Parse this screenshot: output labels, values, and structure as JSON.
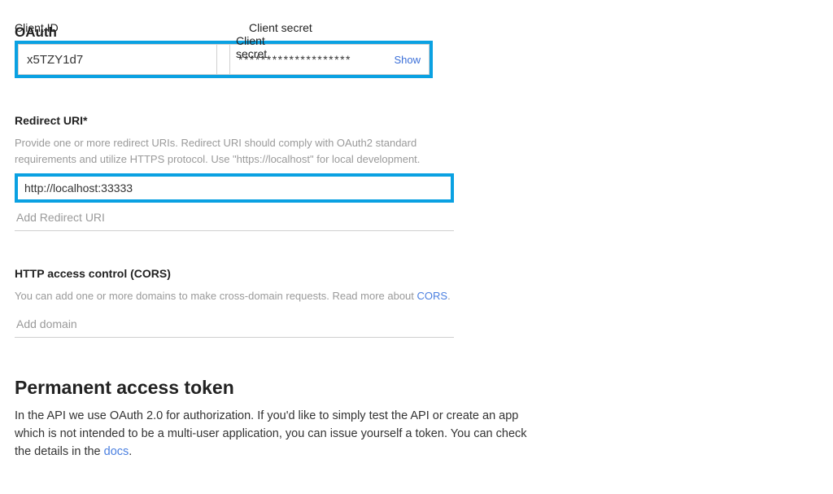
{
  "oauth": {
    "title": "OAuth",
    "client_id_label": "Client ID",
    "client_id_value": "x5TZY1d7",
    "client_secret_label": "Client secret",
    "client_secret_mask": "********************",
    "show_label": "Show"
  },
  "redirect": {
    "label": "Redirect URI*",
    "helper": "Provide one or more redirect URIs. Redirect URI should comply with OAuth2 standard requirements and utilize HTTPS protocol. Use \"https://localhost\" for local development.",
    "value": "http://localhost:33333",
    "add_label": "Add Redirect URI"
  },
  "cors": {
    "label": "HTTP access control (CORS)",
    "helper_pre": "You can add one or more domains to make cross-domain requests. Read more about ",
    "helper_link": "CORS",
    "helper_post": ".",
    "add_label": "Add domain"
  },
  "token": {
    "heading": "Permanent access token",
    "body_pre": "In the API we use OAuth 2.0 for authorization. If you'd like to simply test the API or create an app which is not intended to be a multi-user application, you can issue yourself a token. You can check the details in the ",
    "body_link": "docs",
    "body_post": "."
  }
}
